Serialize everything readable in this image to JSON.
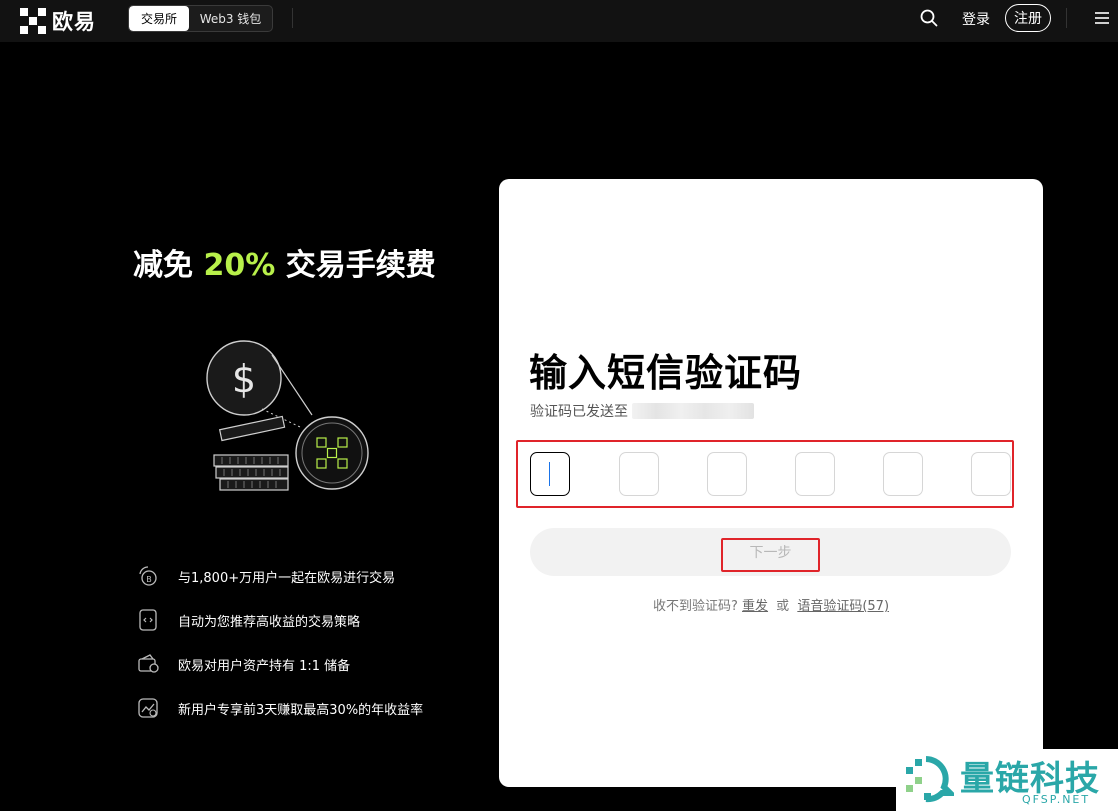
{
  "topbar": {
    "brand": "欧易",
    "tabs": [
      {
        "label": "交易所",
        "active": true
      },
      {
        "label": "Web3 钱包",
        "active": false
      }
    ],
    "login_label": "登录",
    "register_label": "注册"
  },
  "promo": {
    "title_prefix": "减免 ",
    "title_highlight": "20%",
    "title_suffix": " 交易手续费",
    "highlight_color": "#b8f04a",
    "features": [
      {
        "icon": "coin-users-icon",
        "text": "与1,800+万用户一起在欧易进行交易"
      },
      {
        "icon": "strategy-doc-icon",
        "text": "自动为您推荐高收益的交易策略"
      },
      {
        "icon": "wallet-reserve-icon",
        "text": "欧易对用户资产持有 1:1 储备"
      },
      {
        "icon": "growth-chart-icon",
        "text": "新用户专享前3天赚取最高30%的年收益率"
      }
    ]
  },
  "verify": {
    "title": "输入短信验证码",
    "sent_label": "验证码已发送至",
    "code_digits": [
      "",
      "",
      "",
      "",
      "",
      ""
    ],
    "next_label": "下一步",
    "no_code_text": "收不到验证码?",
    "resend_label": "重发",
    "or_text": "或",
    "voice_code_label": "语音验证码(57)"
  },
  "watermark": {
    "name": "量链科技",
    "url": "QFSP.NET",
    "color": "#2aa7a8"
  },
  "colors": {
    "highlight_outline": "#e0242a",
    "accent_green": "#b8f04a"
  }
}
